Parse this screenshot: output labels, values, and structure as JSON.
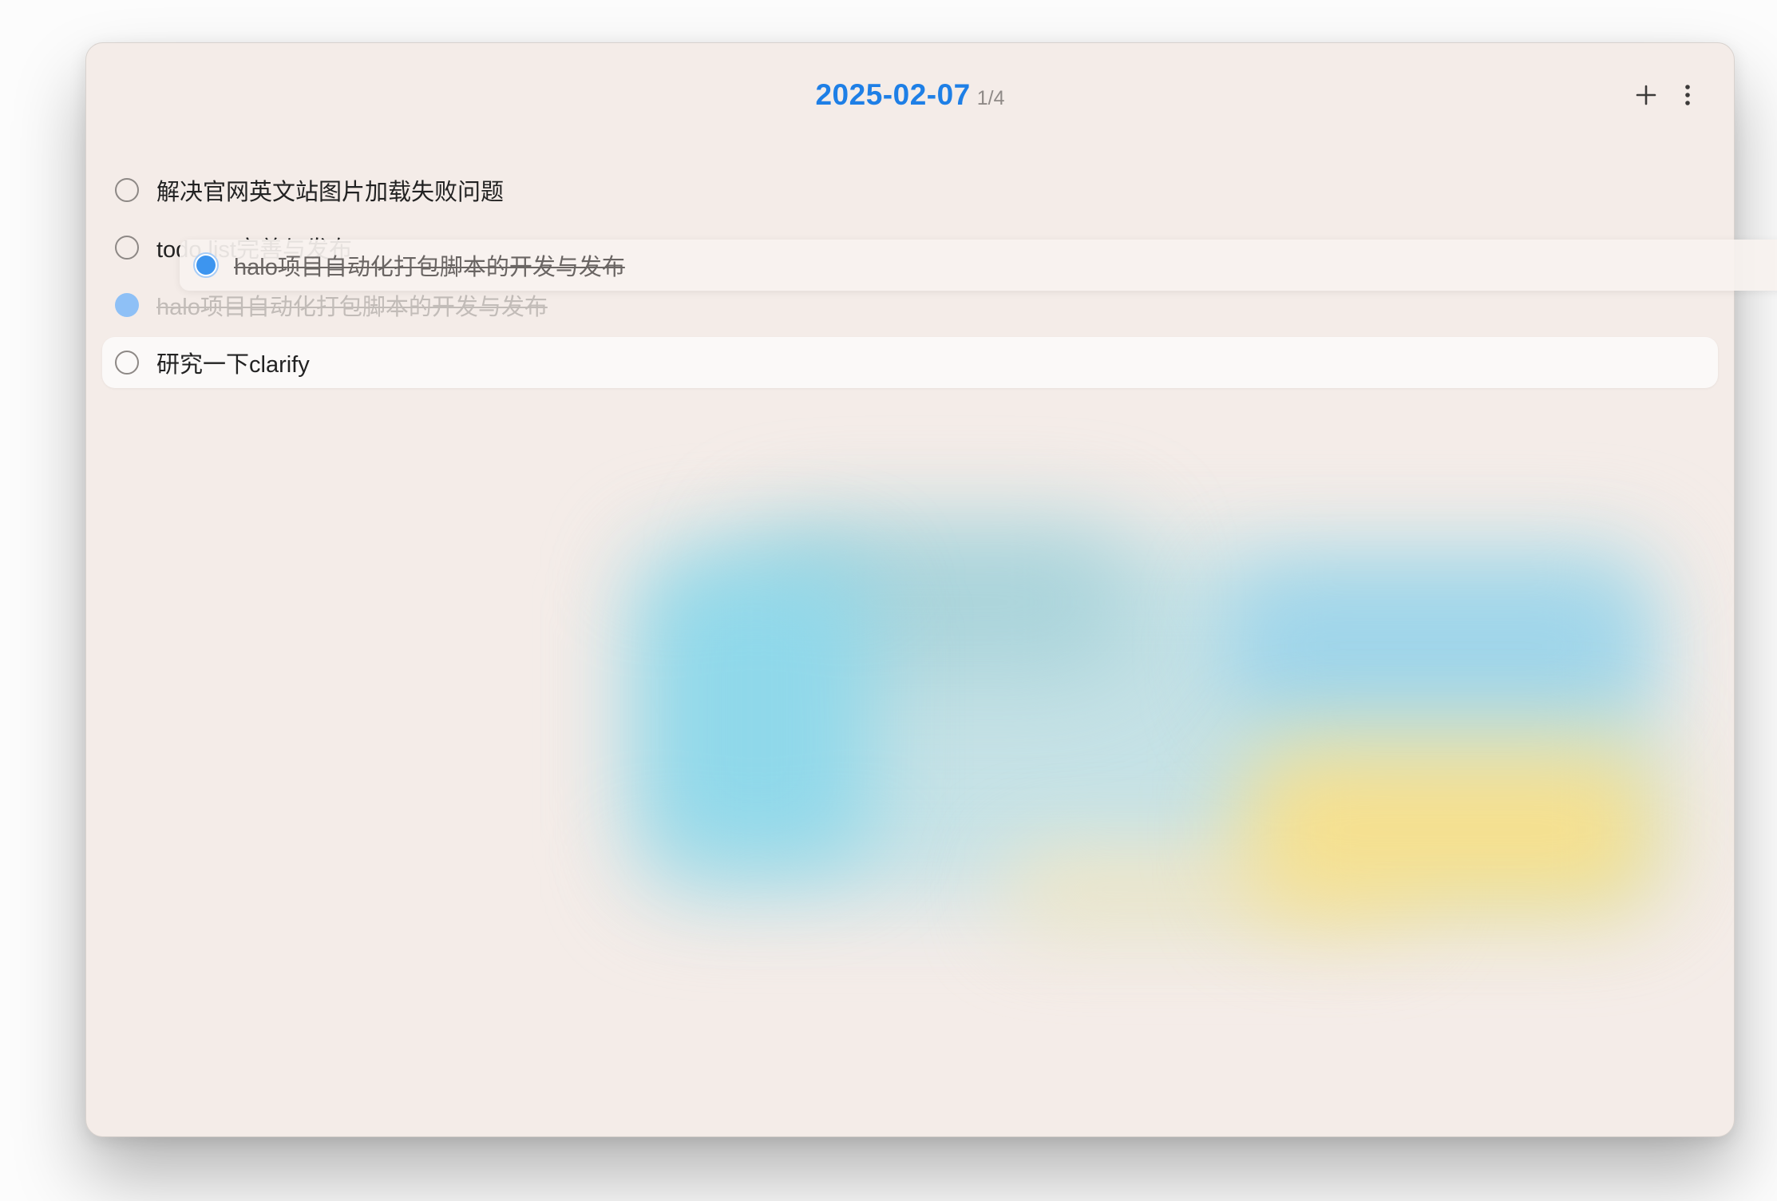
{
  "header": {
    "date": "2025-02-07",
    "count": "1/4",
    "add_icon": "plus-icon",
    "more_icon": "vertical-ellipsis-icon"
  },
  "todos": [
    {
      "text": "解决官网英文站图片加载失败问题",
      "done": false,
      "state": "normal"
    },
    {
      "text": "todo list完善与发布",
      "done": false,
      "state": "normal"
    },
    {
      "text": "halo项目自动化打包脚本的开发与发布",
      "done": true,
      "state": "drag-placeholder"
    },
    {
      "text": "研究一下clarify",
      "done": false,
      "state": "hovered"
    }
  ],
  "dragging": {
    "text": "halo项目自动化打包脚本的开发与发布",
    "done": true
  },
  "colors": {
    "accent": "#1e7fe6",
    "window_bg": "#f4ece8",
    "checked": "#3d95ef",
    "text": "#222222",
    "muted": "#8f8a87"
  }
}
